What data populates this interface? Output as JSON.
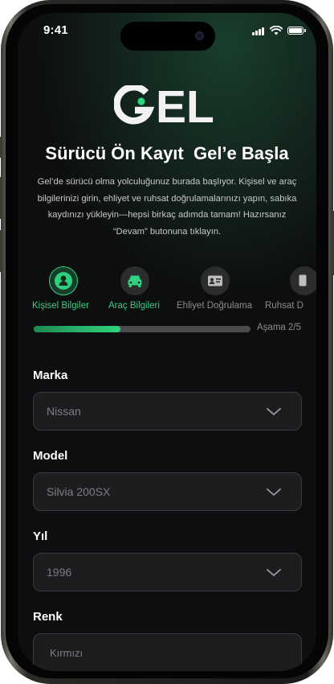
{
  "status_bar": {
    "time": "9:41"
  },
  "brand": {
    "logo_text": "GEL",
    "accent": "#31d17f"
  },
  "header": {
    "title": "Sürücü Ön Kayıt  Gel’e Başla",
    "description": "Gel’de sürücü olma yolculuğunuz burada başlıyor. Kişisel ve araç bilgilerinizi girin, ehliyet ve ruhsat doğrulamalarınızı yapın, sabıka kaydınızı yükleyin—hepsi birkaç adımda tamam! Hazırsanız “Devam” butonuna tıklayın."
  },
  "steps": [
    {
      "label": "Kişisel Bilgiler",
      "icon": "person-icon",
      "state": "completed"
    },
    {
      "label": "Araç Bilgileri",
      "icon": "car-icon",
      "state": "active"
    },
    {
      "label": "Ehliyet Doğrulama",
      "icon": "id-card-icon",
      "state": "pending"
    },
    {
      "label": "Ruhsat D",
      "icon": "document-icon",
      "state": "pending"
    }
  ],
  "progress": {
    "fraction": 0.4,
    "stage_text": "Aşama 2/5"
  },
  "form": {
    "marka": {
      "label": "Marka",
      "value": "Nissan"
    },
    "model": {
      "label": "Model",
      "value": "Silvia 200SX"
    },
    "yil": {
      "label": "Yıl",
      "value": "1996"
    },
    "renk": {
      "label": "Renk",
      "placeholder": "Kırmızı"
    }
  },
  "colors": {
    "background": "#0d0e0f",
    "accent": "#31d17f",
    "field_bg": "#1c1d1f",
    "field_border": "#3a3b3e",
    "muted_text": "#7c7d80"
  }
}
